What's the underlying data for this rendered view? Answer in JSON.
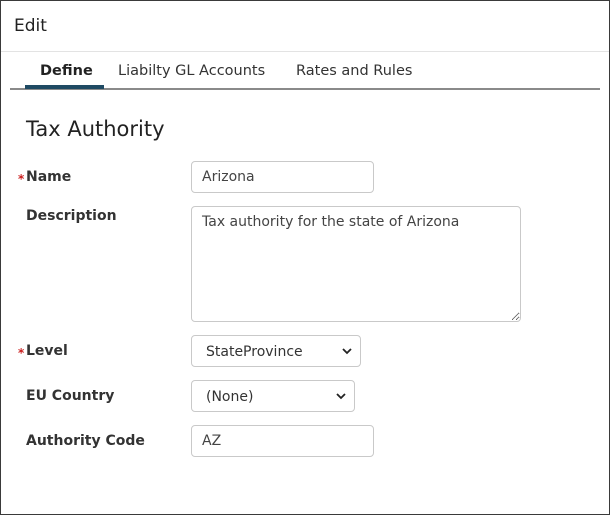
{
  "header": {
    "title": "Edit"
  },
  "tabs": [
    {
      "label": "Define",
      "active": true
    },
    {
      "label": "Liabilty GL Accounts",
      "active": false
    },
    {
      "label": "Rates and Rules",
      "active": false
    }
  ],
  "section": {
    "title": "Tax Authority"
  },
  "form": {
    "required_marker": "*",
    "name": {
      "label": "Name",
      "value": "Arizona",
      "required": true
    },
    "description": {
      "label": "Description",
      "value": "Tax authority for the state of Arizona"
    },
    "level": {
      "label": "Level",
      "value": "StateProvince",
      "required": true
    },
    "eu_country": {
      "label": "EU Country",
      "value": "(None)"
    },
    "authority_code": {
      "label": "Authority Code",
      "value": "AZ"
    }
  },
  "icons": {
    "dropdown": "chevron-down-icon",
    "resize": "resize-grip-icon"
  },
  "colors": {
    "accent": "#1f4a63",
    "required": "#cc2222",
    "border": "#c9c9c9"
  }
}
